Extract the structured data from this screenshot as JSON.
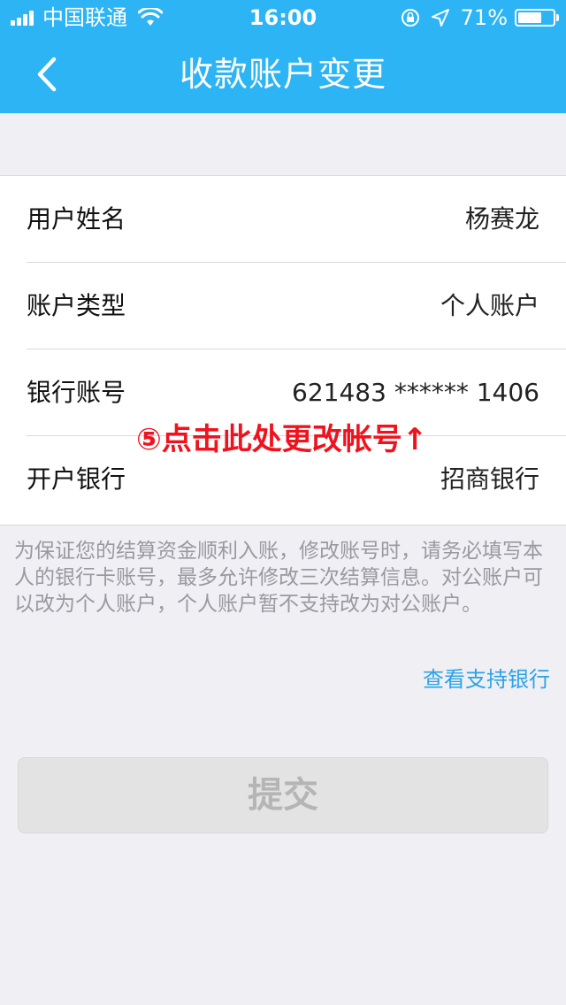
{
  "status_bar": {
    "carrier": "中国联通",
    "time": "16:00",
    "battery": "71%",
    "battery_level": 0.71
  },
  "nav": {
    "title": "收款账户变更",
    "back_icon": "chevron-left-icon"
  },
  "form": {
    "rows": [
      {
        "label": "用户姓名",
        "value": "杨赛龙"
      },
      {
        "label": "账户类型",
        "value": "个人账户"
      },
      {
        "label": "银行账号",
        "value": "621483 ****** 1406"
      },
      {
        "label": "开户银行",
        "value": "招商银行"
      }
    ]
  },
  "annotation": "⑤点击此处更改帐号↑",
  "notice": "为保证您的结算资金顺利入账，修改账号时，请务必填写本人的银行卡账号，最多允许修改三次结算信息。对公账户可以改为个人账户，个人账户暂不支持改为对公账户。",
  "link_banks": "查看支持银行",
  "submit_label": "提交",
  "colors": {
    "header": "#2cb4f5",
    "annotation": "#f0131e",
    "link": "#2ba3e6"
  }
}
